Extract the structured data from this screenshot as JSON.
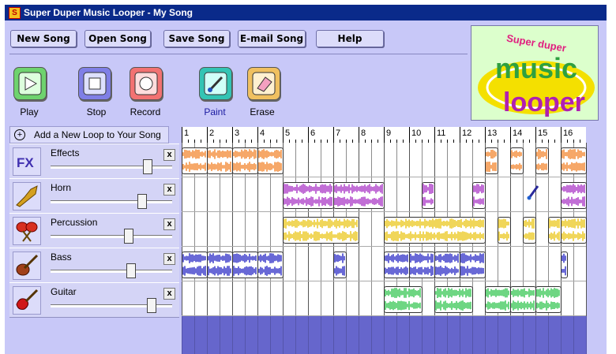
{
  "window": {
    "title": "Super Duper Music Looper - My Song",
    "app_icon": "S"
  },
  "menu": [
    {
      "label": "New Song"
    },
    {
      "label": "Open Song"
    },
    {
      "label": "Save Song"
    },
    {
      "label": "E-mail Song"
    },
    {
      "label": "Help"
    }
  ],
  "logo": {
    "line1": "Super duper",
    "line2": "music",
    "line3": "looper"
  },
  "tools": [
    {
      "label": "Play",
      "icon": "play-icon",
      "color": "#6ed36e"
    },
    {
      "label": "Stop",
      "icon": "stop-icon",
      "color": "#7f7fe6"
    },
    {
      "label": "Record",
      "icon": "record-icon",
      "color": "#f27272"
    },
    {
      "label": "Paint",
      "icon": "paintbrush-icon",
      "color": "#33c4b4",
      "active": true
    },
    {
      "label": "Erase",
      "icon": "eraser-icon",
      "color": "#f0c060"
    }
  ],
  "add_loop": {
    "label": "Add a New Loop to Your Song",
    "icon": "plus-icon"
  },
  "ruler": [
    "1",
    "2",
    "3",
    "4",
    "5",
    "6",
    "7",
    "8",
    "9",
    "10",
    "11",
    "12",
    "13",
    "14",
    "15",
    "16"
  ],
  "tracks": [
    {
      "name": "Effects",
      "icon": "fx-icon",
      "color": "#f07818",
      "volume": 0.85,
      "segments": [
        [
          0,
          1
        ],
        [
          1,
          2
        ],
        [
          2,
          3
        ],
        [
          3,
          4
        ],
        [
          12,
          12.5
        ],
        [
          13,
          13.5
        ],
        [
          14,
          14.5
        ],
        [
          15,
          16
        ]
      ]
    },
    {
      "name": "Horn",
      "icon": "horn-icon",
      "color": "#a020c0",
      "volume": 0.8,
      "segments": [
        [
          4,
          6
        ],
        [
          6,
          8
        ],
        [
          9.5,
          10
        ],
        [
          11.5,
          12
        ],
        [
          15,
          16
        ]
      ]
    },
    {
      "name": "Percussion",
      "icon": "maracas-icon",
      "color": "#e8c000",
      "volume": 0.68,
      "segments": [
        [
          4,
          7
        ],
        [
          8,
          12
        ],
        [
          12.5,
          13
        ],
        [
          13.5,
          14
        ],
        [
          14.5,
          15
        ],
        [
          15,
          16
        ]
      ]
    },
    {
      "name": "Bass",
      "icon": "bass-guitar-icon",
      "color": "#1818c0",
      "volume": 0.7,
      "segments": [
        [
          0,
          1
        ],
        [
          1,
          2
        ],
        [
          2,
          3
        ],
        [
          3,
          4
        ],
        [
          6,
          6.5
        ],
        [
          8,
          9
        ],
        [
          9,
          10
        ],
        [
          10,
          11
        ],
        [
          11,
          12
        ],
        [
          15,
          15.25
        ]
      ]
    },
    {
      "name": "Guitar",
      "icon": "electric-guitar-icon",
      "color": "#20c040",
      "volume": 0.88,
      "segments": [
        [
          8,
          9.5
        ],
        [
          10,
          11.5
        ],
        [
          12,
          13
        ],
        [
          13,
          14
        ],
        [
          14,
          15
        ]
      ]
    }
  ],
  "close_label": "x"
}
